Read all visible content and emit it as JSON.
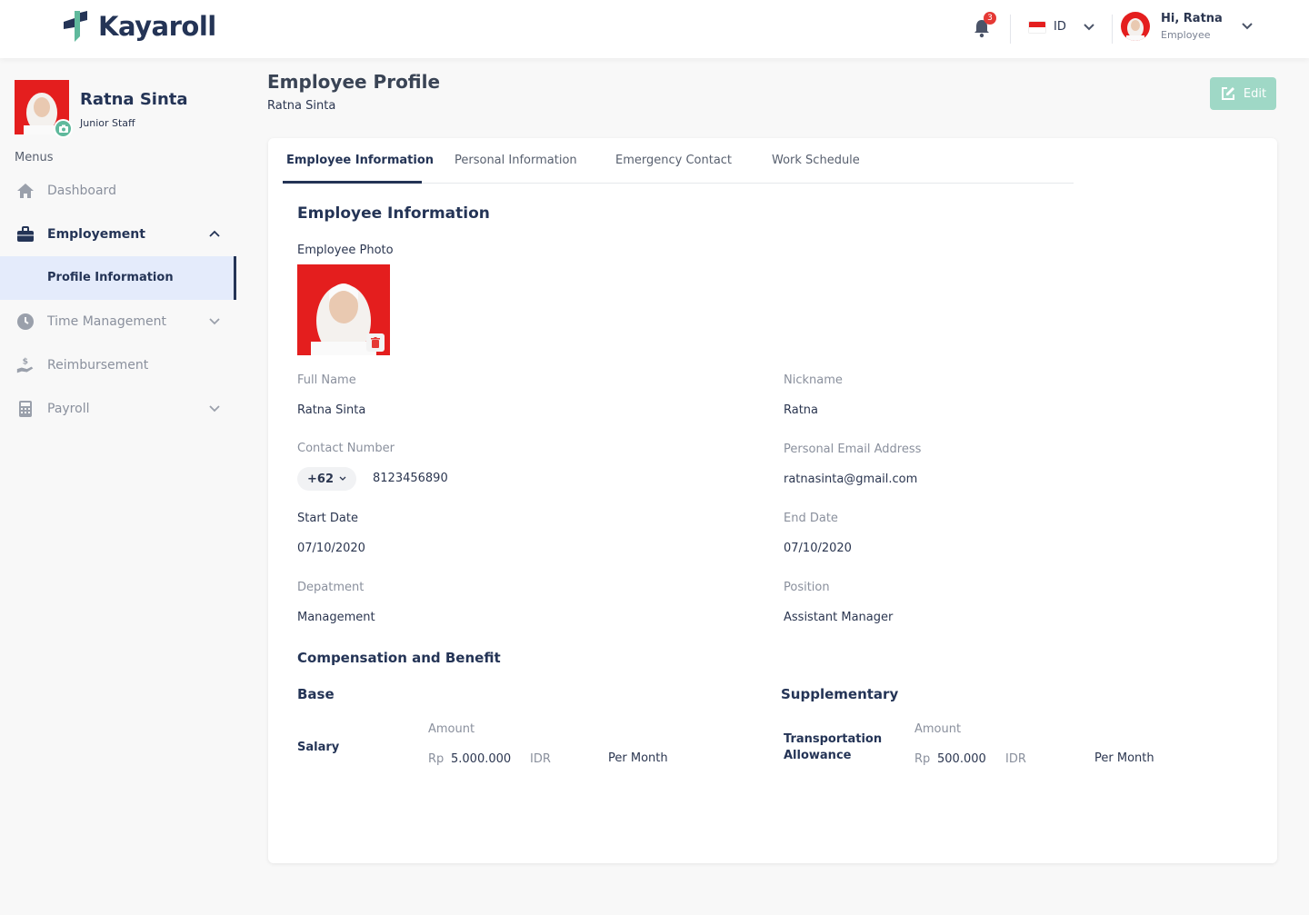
{
  "app": {
    "name": "Kayaroll"
  },
  "header": {
    "notification_count": "3",
    "language": "ID",
    "user_greeting": "Hi, Ratna",
    "user_role": "Employee"
  },
  "sidebar": {
    "profile_name": "Ratna Sinta",
    "profile_role": "Junior Staff",
    "menus_label": "Menus",
    "items": [
      {
        "label": "Dashboard",
        "icon": "home-icon"
      },
      {
        "label": "Employement",
        "icon": "briefcase-icon",
        "expanded": true
      },
      {
        "label": "Profile Information",
        "active": true
      },
      {
        "label": "Time Management",
        "icon": "clock-icon"
      },
      {
        "label": "Reimbursement",
        "icon": "hand-money-icon"
      },
      {
        "label": "Payroll",
        "icon": "calculator-icon"
      }
    ]
  },
  "page": {
    "title": "Employee Profile",
    "subtitle": "Ratna Sinta",
    "edit_label": "Edit"
  },
  "tabs": [
    {
      "label": "Employee Information",
      "active": true
    },
    {
      "label": "Personal Information"
    },
    {
      "label": "Emergency Contact"
    },
    {
      "label": "Work Schedule"
    }
  ],
  "employee": {
    "section_title": "Employee Information",
    "photo_label": "Employee Photo",
    "full_name_label": "Full Name",
    "full_name": "Ratna Sinta",
    "nickname_label": "Nickname",
    "nickname": "Ratna",
    "contact_label": "Contact Number",
    "country_code": "+62",
    "contact_number": "8123456890",
    "email_label": "Personal Email Address",
    "email": "ratnasinta@gmail.com",
    "start_date_label": "Start Date",
    "start_date": "07/10/2020",
    "end_date_label": "End Date",
    "end_date": "07/10/2020",
    "department_label": "Depatment",
    "department": "Management",
    "position_label": "Position",
    "position": "Assistant Manager"
  },
  "compensation": {
    "title": "Compensation and Benefit",
    "base": {
      "title": "Base",
      "item_label": "Salary",
      "amount_label": "Amount",
      "currency_prefix": "Rp",
      "amount": "5.000.000",
      "currency": "IDR",
      "period": "Per Month"
    },
    "supplementary": {
      "title": "Supplementary",
      "item_label_line1": "Transportation",
      "item_label_line2": "Allowance",
      "amount_label": "Amount",
      "currency_prefix": "Rp",
      "amount": "500.000",
      "currency": "IDR",
      "period": "Per Month"
    }
  },
  "colors": {
    "primary": "#243456",
    "accent_green": "#5fb99c",
    "edit_button": "#9fd8c6",
    "active_nav_bg": "#e4ebfb",
    "photo_bg": "#e41e1e"
  }
}
